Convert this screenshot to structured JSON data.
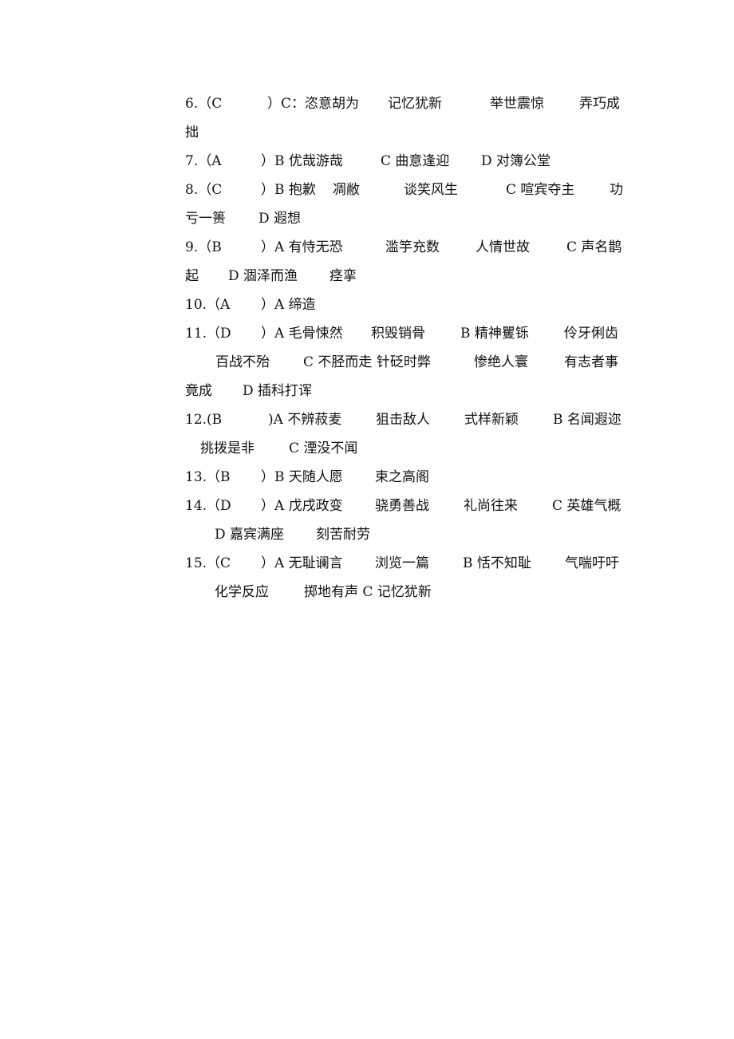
{
  "document": {
    "items": [
      {
        "number": "6.",
        "answer": "C",
        "lines": [
          [
            "6.（C",
            "）C：恣意胡为",
            "记忆犹新",
            "举世震惊",
            "弄巧成"
          ],
          [
            "拙"
          ]
        ]
      },
      {
        "number": "7.",
        "answer": "A",
        "lines": [
          [
            "7.（A",
            "）B 优哉游哉",
            "C 曲意逢迎",
            "D 对簿公堂"
          ]
        ]
      },
      {
        "number": "8.",
        "answer": "C",
        "lines": [
          [
            "8.（C",
            "）B 抱歉",
            "凋敝",
            "谈笑风生",
            "C 喧宾夺主",
            "功"
          ],
          [
            "亏一篑",
            "D 遐想"
          ]
        ]
      },
      {
        "number": "9.",
        "answer": "B",
        "lines": [
          [
            "9.（B",
            "）A 有恃无恐",
            "滥竽充数",
            "人情世故",
            "C 声名鹊"
          ],
          [
            "起",
            "D 涸泽而渔",
            "痉挛"
          ]
        ]
      },
      {
        "number": "10.",
        "answer": "A",
        "lines": [
          [
            "10.（A",
            "）A 缔造"
          ]
        ]
      },
      {
        "number": "11.",
        "answer": "D",
        "lines": [
          [
            "11.（D",
            "）A 毛骨悚然",
            "积毁销骨",
            "B 精神矍铄",
            "伶牙俐齿"
          ],
          [
            "百战不殆",
            "C 不胫而走 针砭时弊",
            "惨绝人寰",
            "有志者事"
          ],
          [
            "竟成",
            "D 插科打诨"
          ]
        ]
      },
      {
        "number": "12.",
        "answer": "B",
        "lines": [
          [
            "12.(B",
            ")A 不辨菽麦",
            "狙击敌人",
            "式样新颖",
            "B 名闻遐迩"
          ],
          [
            "挑拨是非",
            "C 湮没不闻"
          ]
        ]
      },
      {
        "number": "13.",
        "answer": "B",
        "lines": [
          [
            "13.（B",
            "）B 天随人愿",
            "束之高阁"
          ]
        ]
      },
      {
        "number": "14.",
        "answer": "D",
        "lines": [
          [
            "14.（D",
            "）A 戊戌政变",
            "骁勇善战",
            "礼尚往来",
            "C 英雄气概"
          ],
          [
            "D 嘉宾满座",
            "刻苦耐劳"
          ]
        ]
      },
      {
        "number": "15.",
        "answer": "C",
        "lines": [
          [
            "15.（C",
            "）A 无耻谰言",
            "浏览一篇",
            "B 恬不知耻",
            "气喘吁吁"
          ],
          [
            "化学反应",
            "掷地有声 C 记忆犹新"
          ]
        ]
      }
    ]
  }
}
